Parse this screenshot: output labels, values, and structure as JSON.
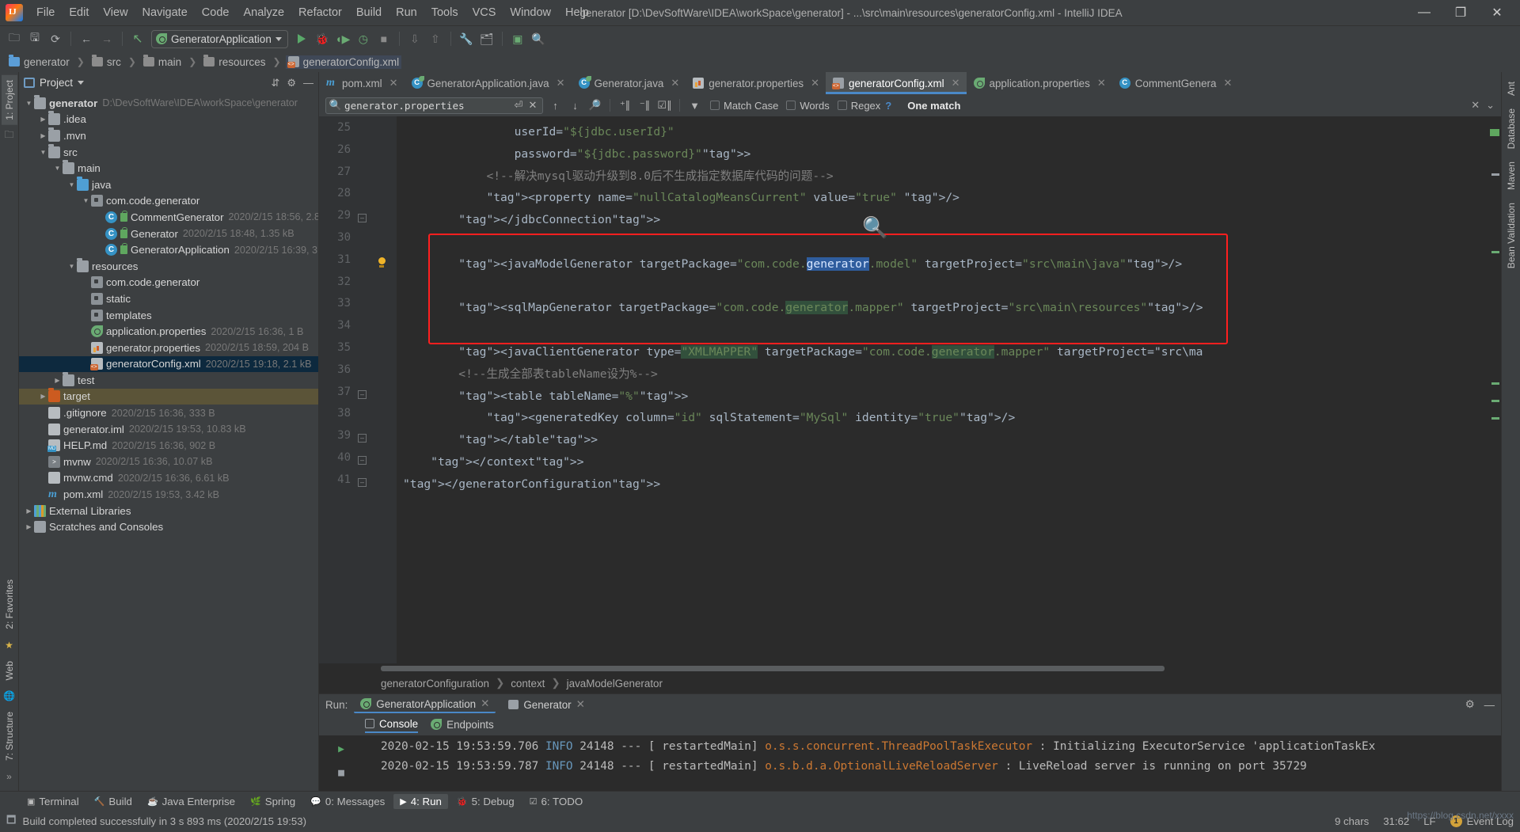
{
  "window": {
    "title": "generator [D:\\DevSoftWare\\IDEA\\workSpace\\generator] - ...\\src\\main\\resources\\generatorConfig.xml - IntelliJ IDEA",
    "minimize": "—",
    "maximize": "❐",
    "close": "✕"
  },
  "menu": [
    "File",
    "Edit",
    "View",
    "Navigate",
    "Code",
    "Analyze",
    "Refactor",
    "Build",
    "Run",
    "Tools",
    "VCS",
    "Window",
    "Help"
  ],
  "toolbar": {
    "run_config": "GeneratorApplication"
  },
  "breadcrumb": [
    "generator",
    "src",
    "main",
    "resources",
    "generatorConfig.xml"
  ],
  "left_strip": {
    "project": "1: Project",
    "favorites": "2: Favorites",
    "web": "Web",
    "structure": "7: Structure"
  },
  "right_strip": {
    "ant": "Ant",
    "database": "Database",
    "maven": "Maven",
    "bean_validation": "Bean Validation"
  },
  "project_panel": {
    "title": "Project",
    "tree": [
      {
        "indent": 0,
        "arrow": "▼",
        "icon": "folder-module",
        "label": "generator",
        "bold": true,
        "meta": "D:\\DevSoftWare\\IDEA\\workSpace\\generator"
      },
      {
        "indent": 1,
        "arrow": "▶",
        "icon": "folder",
        "label": ".idea",
        "meta": ""
      },
      {
        "indent": 1,
        "arrow": "▶",
        "icon": "folder",
        "label": ".mvn",
        "meta": ""
      },
      {
        "indent": 1,
        "arrow": "▼",
        "icon": "folder",
        "label": "src",
        "meta": ""
      },
      {
        "indent": 2,
        "arrow": "▼",
        "icon": "folder",
        "label": "main",
        "meta": ""
      },
      {
        "indent": 3,
        "arrow": "▼",
        "icon": "folder-src",
        "label": "java",
        "meta": ""
      },
      {
        "indent": 4,
        "arrow": "▼",
        "icon": "package",
        "label": "com.code.generator",
        "meta": ""
      },
      {
        "indent": 5,
        "arrow": "",
        "icon": "class",
        "label": "CommentGenerator",
        "meta": "2020/2/15 18:56, 2.8"
      },
      {
        "indent": 5,
        "arrow": "",
        "icon": "class-run",
        "label": "Generator",
        "meta": "2020/2/15 18:48, 1.35 kB"
      },
      {
        "indent": 5,
        "arrow": "",
        "icon": "class-spring",
        "label": "GeneratorApplication",
        "meta": "2020/2/15 16:39, 3"
      },
      {
        "indent": 3,
        "arrow": "▼",
        "icon": "folder-res",
        "label": "resources",
        "meta": ""
      },
      {
        "indent": 4,
        "arrow": "",
        "icon": "package",
        "label": "com.code.generator",
        "meta": ""
      },
      {
        "indent": 4,
        "arrow": "",
        "icon": "package",
        "label": "static",
        "meta": ""
      },
      {
        "indent": 4,
        "arrow": "",
        "icon": "package",
        "label": "templates",
        "meta": ""
      },
      {
        "indent": 4,
        "arrow": "",
        "icon": "spring-prop",
        "label": "application.properties",
        "meta": "2020/2/15 16:36, 1 B"
      },
      {
        "indent": 4,
        "arrow": "",
        "icon": "properties",
        "label": "generator.properties",
        "meta": "2020/2/15 18:59, 204 B"
      },
      {
        "indent": 4,
        "arrow": "",
        "icon": "xml",
        "label": "generatorConfig.xml",
        "meta": "2020/2/15 19:18, 2.1 kB",
        "selected": true
      },
      {
        "indent": 2,
        "arrow": "▶",
        "icon": "folder",
        "label": "test",
        "meta": ""
      },
      {
        "indent": 1,
        "arrow": "▶",
        "icon": "folder-target",
        "label": "target",
        "meta": "",
        "target": true
      },
      {
        "indent": 1,
        "arrow": "",
        "icon": "gitignore",
        "label": ".gitignore",
        "meta": "2020/2/15 16:36, 333 B"
      },
      {
        "indent": 1,
        "arrow": "",
        "icon": "iml",
        "label": "generator.iml",
        "meta": "2020/2/15 19:53, 10.83 kB"
      },
      {
        "indent": 1,
        "arrow": "",
        "icon": "md",
        "label": "HELP.md",
        "meta": "2020/2/15 16:36, 902 B"
      },
      {
        "indent": 1,
        "arrow": "",
        "icon": "shell",
        "label": "mvnw",
        "meta": "2020/2/15 16:36, 10.07 kB"
      },
      {
        "indent": 1,
        "arrow": "",
        "icon": "cmd",
        "label": "mvnw.cmd",
        "meta": "2020/2/15 16:36, 6.61 kB"
      },
      {
        "indent": 1,
        "arrow": "",
        "icon": "maven",
        "label": "pom.xml",
        "meta": "2020/2/15 19:53, 3.42 kB"
      },
      {
        "indent": 0,
        "arrow": "▶",
        "icon": "libs",
        "label": "External Libraries",
        "meta": ""
      },
      {
        "indent": 0,
        "arrow": "▶",
        "icon": "scratch",
        "label": "Scratches and Consoles",
        "meta": ""
      }
    ]
  },
  "editor_tabs": [
    {
      "label": "pom.xml",
      "icon": "maven-icon",
      "active": false
    },
    {
      "label": "GeneratorApplication.java",
      "icon": "class-spring-icon",
      "active": false
    },
    {
      "label": "Generator.java",
      "icon": "class-run-icon",
      "active": false
    },
    {
      "label": "generator.properties",
      "icon": "properties-icon",
      "active": false
    },
    {
      "label": "generatorConfig.xml",
      "icon": "xml-icon",
      "active": true
    },
    {
      "label": "application.properties",
      "icon": "spring-properties-icon",
      "active": false
    },
    {
      "label": "CommentGenera",
      "icon": "class-icon",
      "active": false
    }
  ],
  "find_bar": {
    "query": "generator.properties",
    "placeholder": "Search",
    "match_case": "Match Case",
    "words": "Words",
    "regex": "Regex",
    "help": "?",
    "result": "One match"
  },
  "code": {
    "lines": [
      {
        "num": "25",
        "text": "                userId=\"${jdbc.userId}\""
      },
      {
        "num": "26",
        "text": "                password=\"${jdbc.password}\">"
      },
      {
        "num": "27",
        "text": "            <!--解决mysql驱动升级到8.0后不生成指定数据库代码的问题-->"
      },
      {
        "num": "28",
        "text": "            <property name=\"nullCatalogMeansCurrent\" value=\"true\" />"
      },
      {
        "num": "29",
        "text": "        </jdbcConnection>"
      },
      {
        "num": "30",
        "text": ""
      },
      {
        "num": "31",
        "text": "        <javaModelGenerator targetPackage=\"com.code.generator.model\" targetProject=\"src\\main\\java\"/>"
      },
      {
        "num": "32",
        "text": ""
      },
      {
        "num": "33",
        "text": "        <sqlMapGenerator targetPackage=\"com.code.generator.mapper\" targetProject=\"src\\main\\resources\"/>"
      },
      {
        "num": "34",
        "text": ""
      },
      {
        "num": "35",
        "text": "        <javaClientGenerator type=\"XMLMAPPER\" targetPackage=\"com.code.generator.mapper\" targetProject=\"src\\ma"
      },
      {
        "num": "36",
        "text": "        <!--生成全部表tableName设为%-->"
      },
      {
        "num": "37",
        "text": "        <table tableName=\"%\">"
      },
      {
        "num": "38",
        "text": "            <generatedKey column=\"id\" sqlStatement=\"MySql\" identity=\"true\"/>"
      },
      {
        "num": "39",
        "text": "        </table>"
      },
      {
        "num": "40",
        "text": "    </context>"
      },
      {
        "num": "41",
        "text": "</generatorConfiguration>"
      }
    ],
    "breadcrumb": [
      "generatorConfiguration",
      "context",
      "javaModelGenerator"
    ]
  },
  "run_panel": {
    "label": "Run:",
    "tabs": [
      {
        "label": "GeneratorApplication",
        "active": true
      },
      {
        "label": "Generator",
        "active": false
      }
    ],
    "sub_tabs": [
      {
        "label": "Console",
        "active": true
      },
      {
        "label": "Endpoints",
        "active": false
      }
    ],
    "console_lines": [
      "2020-02-15 19:53:59.706  INFO 24148 --- [  restartedMain] o.s.s.concurrent.ThreadPoolTaskExecutor  : Initializing ExecutorService 'applicationTaskEx",
      "2020-02-15 19:53:59.787  INFO 24148 --- [  restartedMain] o.s.b.d.a.OptionalLiveReloadServer       : LiveReload server is running on port 35729"
    ]
  },
  "tool_windows": [
    {
      "label": "Terminal",
      "icon": "terminal-icon",
      "active": false
    },
    {
      "label": "Build",
      "icon": "hammer-icon",
      "active": false
    },
    {
      "label": "Java Enterprise",
      "icon": "java-icon",
      "active": false
    },
    {
      "label": "Spring",
      "icon": "leaf-icon",
      "active": false
    },
    {
      "label": "0: Messages",
      "icon": "message-icon",
      "active": false
    },
    {
      "label": "4: Run",
      "icon": "play-icon",
      "active": true
    },
    {
      "label": "5: Debug",
      "icon": "bug-icon",
      "active": false
    },
    {
      "label": "6: TODO",
      "icon": "todo-icon",
      "active": false
    }
  ],
  "status_bar": {
    "message": "Build completed successfully in 3 s 893 ms (2020/2/15 19:53)",
    "chars": "9 chars",
    "caret": "31:62",
    "line_sep": "LF",
    "event_log": "Event Log",
    "event_count": "1",
    "watermark": "https://blog.csdn.net/xxxx"
  },
  "colors": {
    "accent": "#4a88c7",
    "highlight_current": "#2f5d9e",
    "highlight_match": "#32503c",
    "red_box": "#ff1f1f",
    "string": "#6a8759",
    "tag": "#e8bf6a",
    "comment": "#808080"
  }
}
